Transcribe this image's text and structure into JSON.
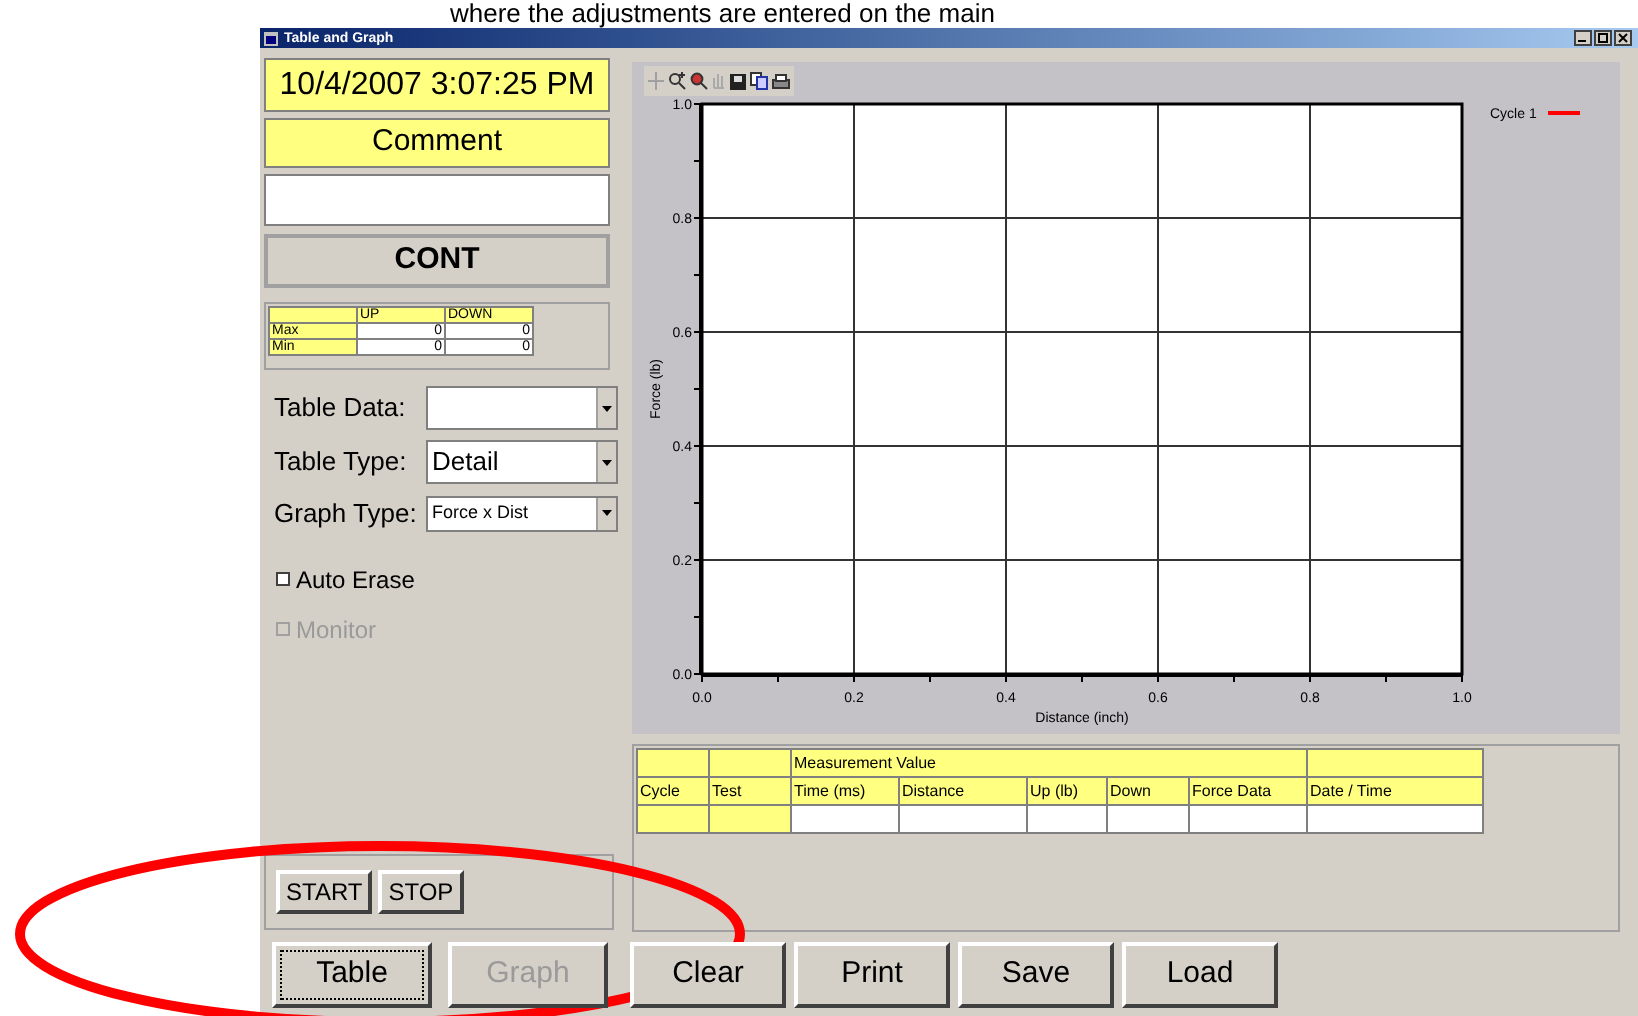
{
  "caption": "where the adjustments are entered on the main",
  "window": {
    "title": "Table and Graph"
  },
  "datetime": "10/4/2007 3:07:25 PM",
  "comment_label": "Comment",
  "mode": "CONT",
  "stats": {
    "columns": [
      "UP",
      "DOWN"
    ],
    "rows": [
      {
        "label": "Max",
        "values": [
          "0",
          "0"
        ]
      },
      {
        "label": "Min",
        "values": [
          "0",
          "0"
        ]
      }
    ]
  },
  "selects": [
    {
      "label": "Table Data:",
      "kind": "normal"
    },
    {
      "label": "Table Type:",
      "value": "Detail",
      "kind": "normal"
    },
    {
      "label": "Graph Type:",
      "value": "Force x Dist",
      "kind": "compact"
    }
  ],
  "options": [
    {
      "label": "Auto Erase",
      "checked": false,
      "disabled": false
    },
    {
      "label": "Monitor",
      "checked": false,
      "disabled": true
    }
  ],
  "run_buttons": [
    "START",
    "STOP"
  ],
  "view_buttons": [
    {
      "label": "Table",
      "selected": true,
      "disabled": false
    },
    {
      "label": "Graph",
      "selected": false,
      "disabled": true
    }
  ],
  "action_buttons": [
    "Clear",
    "Print",
    "Save",
    "Load"
  ],
  "chart": {
    "chart_data": {
      "type": "line",
      "xlabel": "Distance (inch)",
      "ylabel": "Force (lb)",
      "ylim": [
        0,
        1
      ],
      "categories": [
        "0.0",
        "0.2",
        "0.4",
        "0.6",
        "0.8",
        "1.0"
      ],
      "yticks": [
        {
          "value": 0,
          "label": "0.0"
        },
        {
          "value": 0.2,
          "label": "0.2"
        },
        {
          "value": 0.4,
          "label": "0.4"
        },
        {
          "value": 0.6,
          "label": "0.6"
        },
        {
          "value": 0.8,
          "label": "0.8"
        },
        {
          "value": 1,
          "label": "1.0"
        }
      ],
      "grid": true,
      "series": [
        {
          "name": "Cycle 1",
          "color": "#ff0000",
          "values": [
            null,
            null,
            null,
            null,
            null,
            null
          ]
        }
      ]
    }
  },
  "measure_table": {
    "group": "Measurement Value",
    "columns": [
      "Cycle",
      "Test",
      "Time (ms)",
      "Distance",
      "Up (lb)",
      "Down",
      "Force Data",
      "Date / Time"
    ]
  },
  "annotations": [
    {
      "kind": "ellipse"
    }
  ]
}
